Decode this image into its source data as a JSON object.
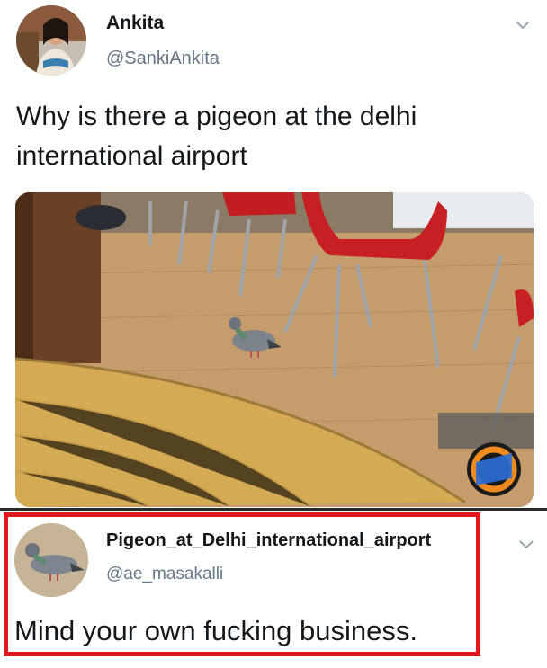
{
  "tweet": {
    "author_name": "Ankita",
    "author_handle": "@SankiAnkita",
    "text": "Why is there a pigeon at the delhi international airport",
    "avatar_icon": "user-avatar-photo",
    "menu_icon": "chevron-down-icon",
    "media_description_icon": "video-photo"
  },
  "reply": {
    "author_name": "Pigeon_at_Delhi_international_airport",
    "author_handle": "@ae_masakalli",
    "text": "Mind your own fucking business.",
    "avatar_icon": "pigeon-avatar-photo",
    "menu_icon": "chevron-down-icon",
    "highlight_color": "#e0181e"
  },
  "colors": {
    "name": "#14171a",
    "handle": "#657786",
    "highlight": "#e0181e"
  }
}
